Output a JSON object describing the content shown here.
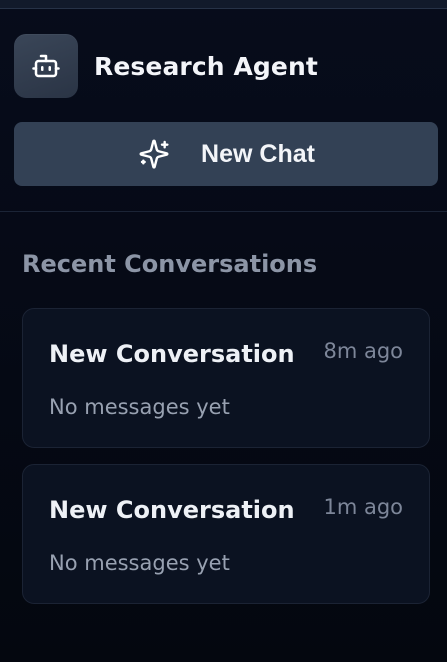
{
  "brand": {
    "title": "Research Agent",
    "icon": "robot-icon"
  },
  "actions": {
    "new_chat_label": "New Chat",
    "new_chat_icon": "sparkles-icon"
  },
  "recent": {
    "heading": "Recent Conversations",
    "conversations": [
      {
        "title": "New Conversation",
        "time": "8m ago",
        "preview": "No messages yet"
      },
      {
        "title": "New Conversation",
        "time": "1m ago",
        "preview": "No messages yet"
      }
    ]
  },
  "colors": {
    "background": "#050a17",
    "button": "#334155",
    "card": "#0b1221",
    "text_primary": "#f3f5f9",
    "text_muted": "#8c95a6"
  }
}
